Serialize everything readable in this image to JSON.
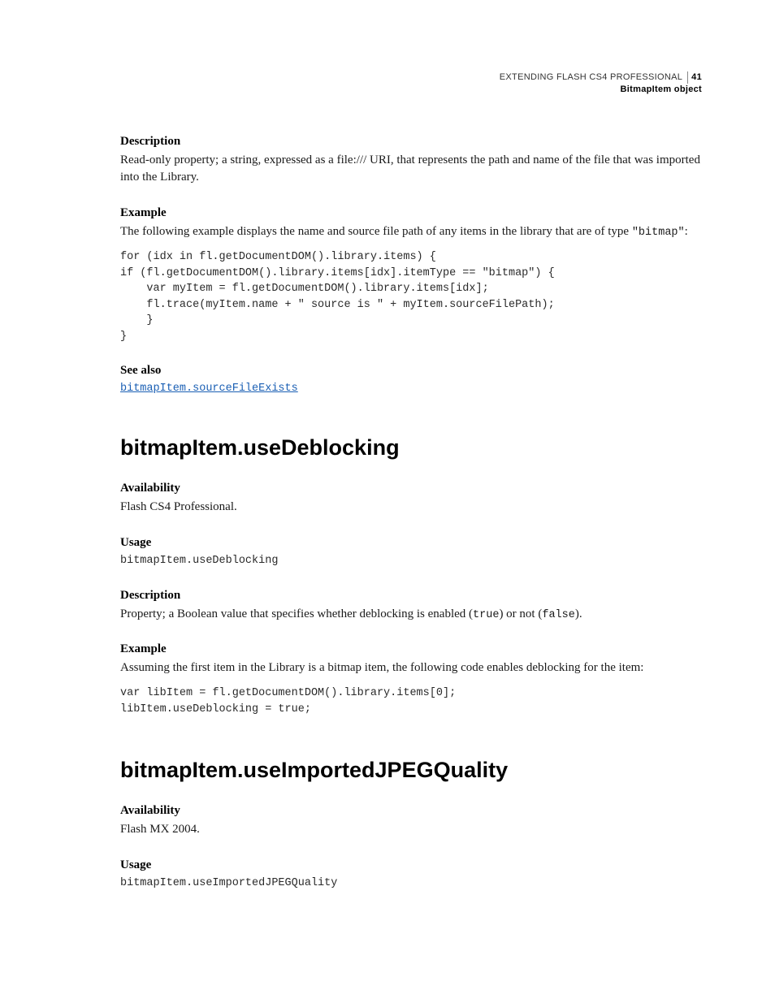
{
  "header": {
    "title": "EXTENDING FLASH CS4 PROFESSIONAL",
    "page_number": "41",
    "section": "BitmapItem object"
  },
  "section1": {
    "description_label": "Description",
    "description_text": "Read-only property; a string, expressed as a file:/// URI, that represents the path and name of the file that was imported into the Library.",
    "example_label": "Example",
    "example_intro_pre": "The following example displays the name and source file path of any items in the library that are of type ",
    "example_intro_code": "\"bitmap\"",
    "example_intro_post": ":",
    "code": "for (idx in fl.getDocumentDOM().library.items) {\nif (fl.getDocumentDOM().library.items[idx].itemType == \"bitmap\") {\n    var myItem = fl.getDocumentDOM().library.items[idx];\n    fl.trace(myItem.name + \" source is \" + myItem.sourceFilePath);\n    }\n}",
    "seealso_label": "See also",
    "seealso_link": "bitmapItem.sourceFileExists"
  },
  "section2": {
    "heading": "bitmapItem.useDeblocking",
    "availability_label": "Availability",
    "availability_text": "Flash CS4 Professional.",
    "usage_label": "Usage",
    "usage_code": "bitmapItem.useDeblocking",
    "description_label": "Description",
    "description_pre": "Property; a Boolean value that specifies whether deblocking is enabled (",
    "description_true": "true",
    "description_mid": ") or not (",
    "description_false": "false",
    "description_post": ").",
    "example_label": "Example",
    "example_intro": "Assuming the first item in the Library is a bitmap item, the following code enables deblocking for the item:",
    "code": "var libItem = fl.getDocumentDOM().library.items[0];\nlibItem.useDeblocking = true;"
  },
  "section3": {
    "heading": "bitmapItem.useImportedJPEGQuality",
    "availability_label": "Availability",
    "availability_text": "Flash MX 2004.",
    "usage_label": "Usage",
    "usage_code": "bitmapItem.useImportedJPEGQuality"
  }
}
